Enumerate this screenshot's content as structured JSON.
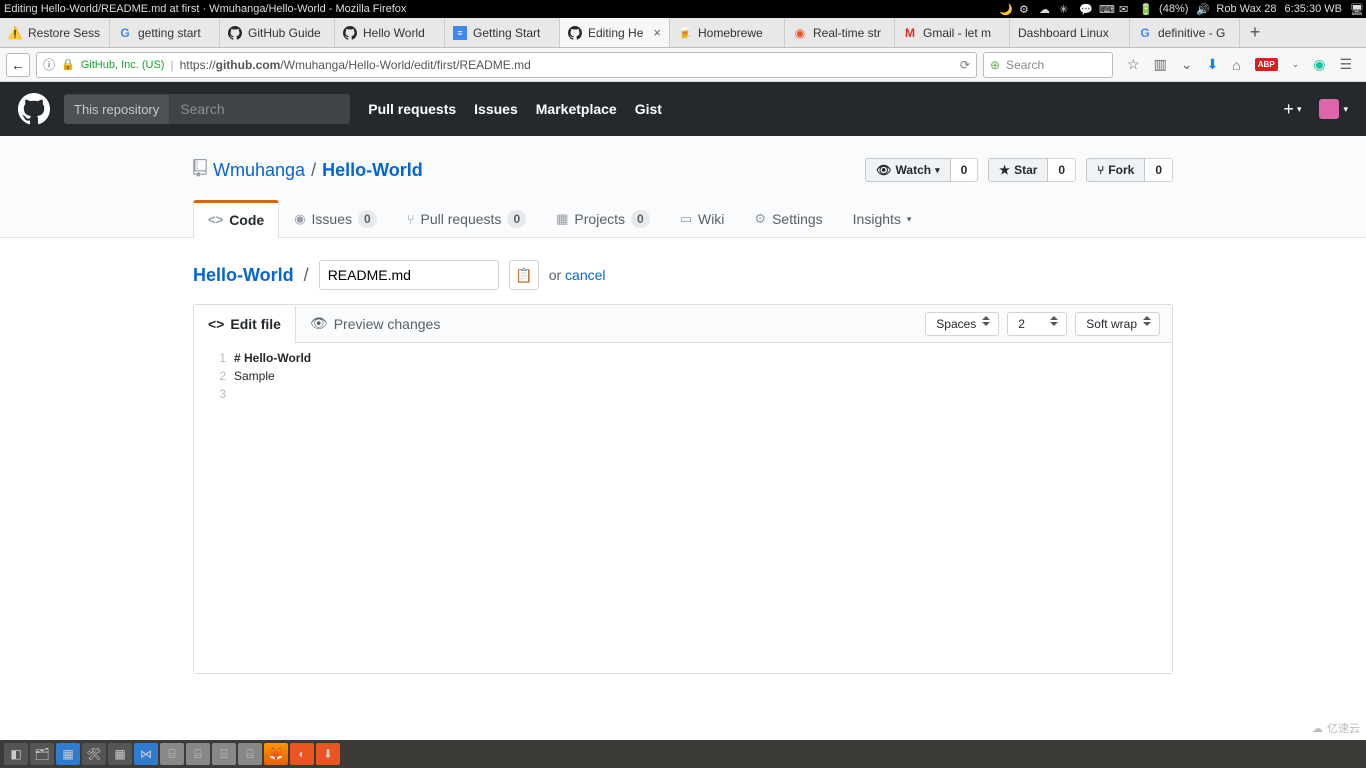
{
  "os": {
    "window_title": "Editing Hello-World/README.md at first · Wmuhanga/Hello-World - Mozilla Firefox",
    "battery": "(48%)",
    "user_date": "Rob Wax 28",
    "time": "6:35:30 WB"
  },
  "browser": {
    "tabs": [
      {
        "label": "Restore Sess",
        "icon": "warn"
      },
      {
        "label": "getting start",
        "icon": "google"
      },
      {
        "label": "GitHub Guide",
        "icon": "github"
      },
      {
        "label": "Hello World",
        "icon": "github"
      },
      {
        "label": "Getting Start",
        "icon": "doc"
      },
      {
        "label": "Editing He",
        "icon": "github",
        "active": true
      },
      {
        "label": "Homebrewe",
        "icon": "brew"
      },
      {
        "label": "Real-time str",
        "icon": "ubuntu"
      },
      {
        "label": "Gmail - let m",
        "icon": "gmail"
      },
      {
        "label": "Dashboard Linux",
        "icon": "none"
      },
      {
        "label": "definitive - G",
        "icon": "google"
      }
    ],
    "identity_org": "GitHub, Inc. (US)",
    "url_prefix": "https://",
    "url_host": "github.com",
    "url_path": "/Wmuhanga/Hello-World/edit/first/README.md",
    "search_placeholder": "Search"
  },
  "github": {
    "search_scope": "This repository",
    "search_placeholder": "Search",
    "nav": {
      "pull": "Pull requests",
      "issues": "Issues",
      "market": "Marketplace",
      "gist": "Gist"
    },
    "owner": "Wmuhanga",
    "repo": "Hello-World",
    "actions": {
      "watch": "Watch",
      "watch_count": "0",
      "star": "Star",
      "star_count": "0",
      "fork": "Fork",
      "fork_count": "0"
    },
    "tabs": {
      "code": "Code",
      "issues": "Issues",
      "issues_count": "0",
      "prs": "Pull requests",
      "prs_count": "0",
      "projects": "Projects",
      "projects_count": "0",
      "wiki": "Wiki",
      "settings": "Settings",
      "insights": "Insights"
    },
    "editor": {
      "repo_link": "Hello-World",
      "filename": "README.md",
      "or": "or ",
      "cancel": "cancel",
      "edit_tab": "Edit file",
      "preview_tab": "Preview changes",
      "indent_mode": "Spaces",
      "indent_size": "2",
      "wrap_mode": "Soft wrap",
      "lines": {
        "n1": "1",
        "n2": "2",
        "n3": "3",
        "l1": "# Hello-World",
        "l2": "Sample",
        "l3": ""
      }
    }
  },
  "watermark": "亿速云"
}
